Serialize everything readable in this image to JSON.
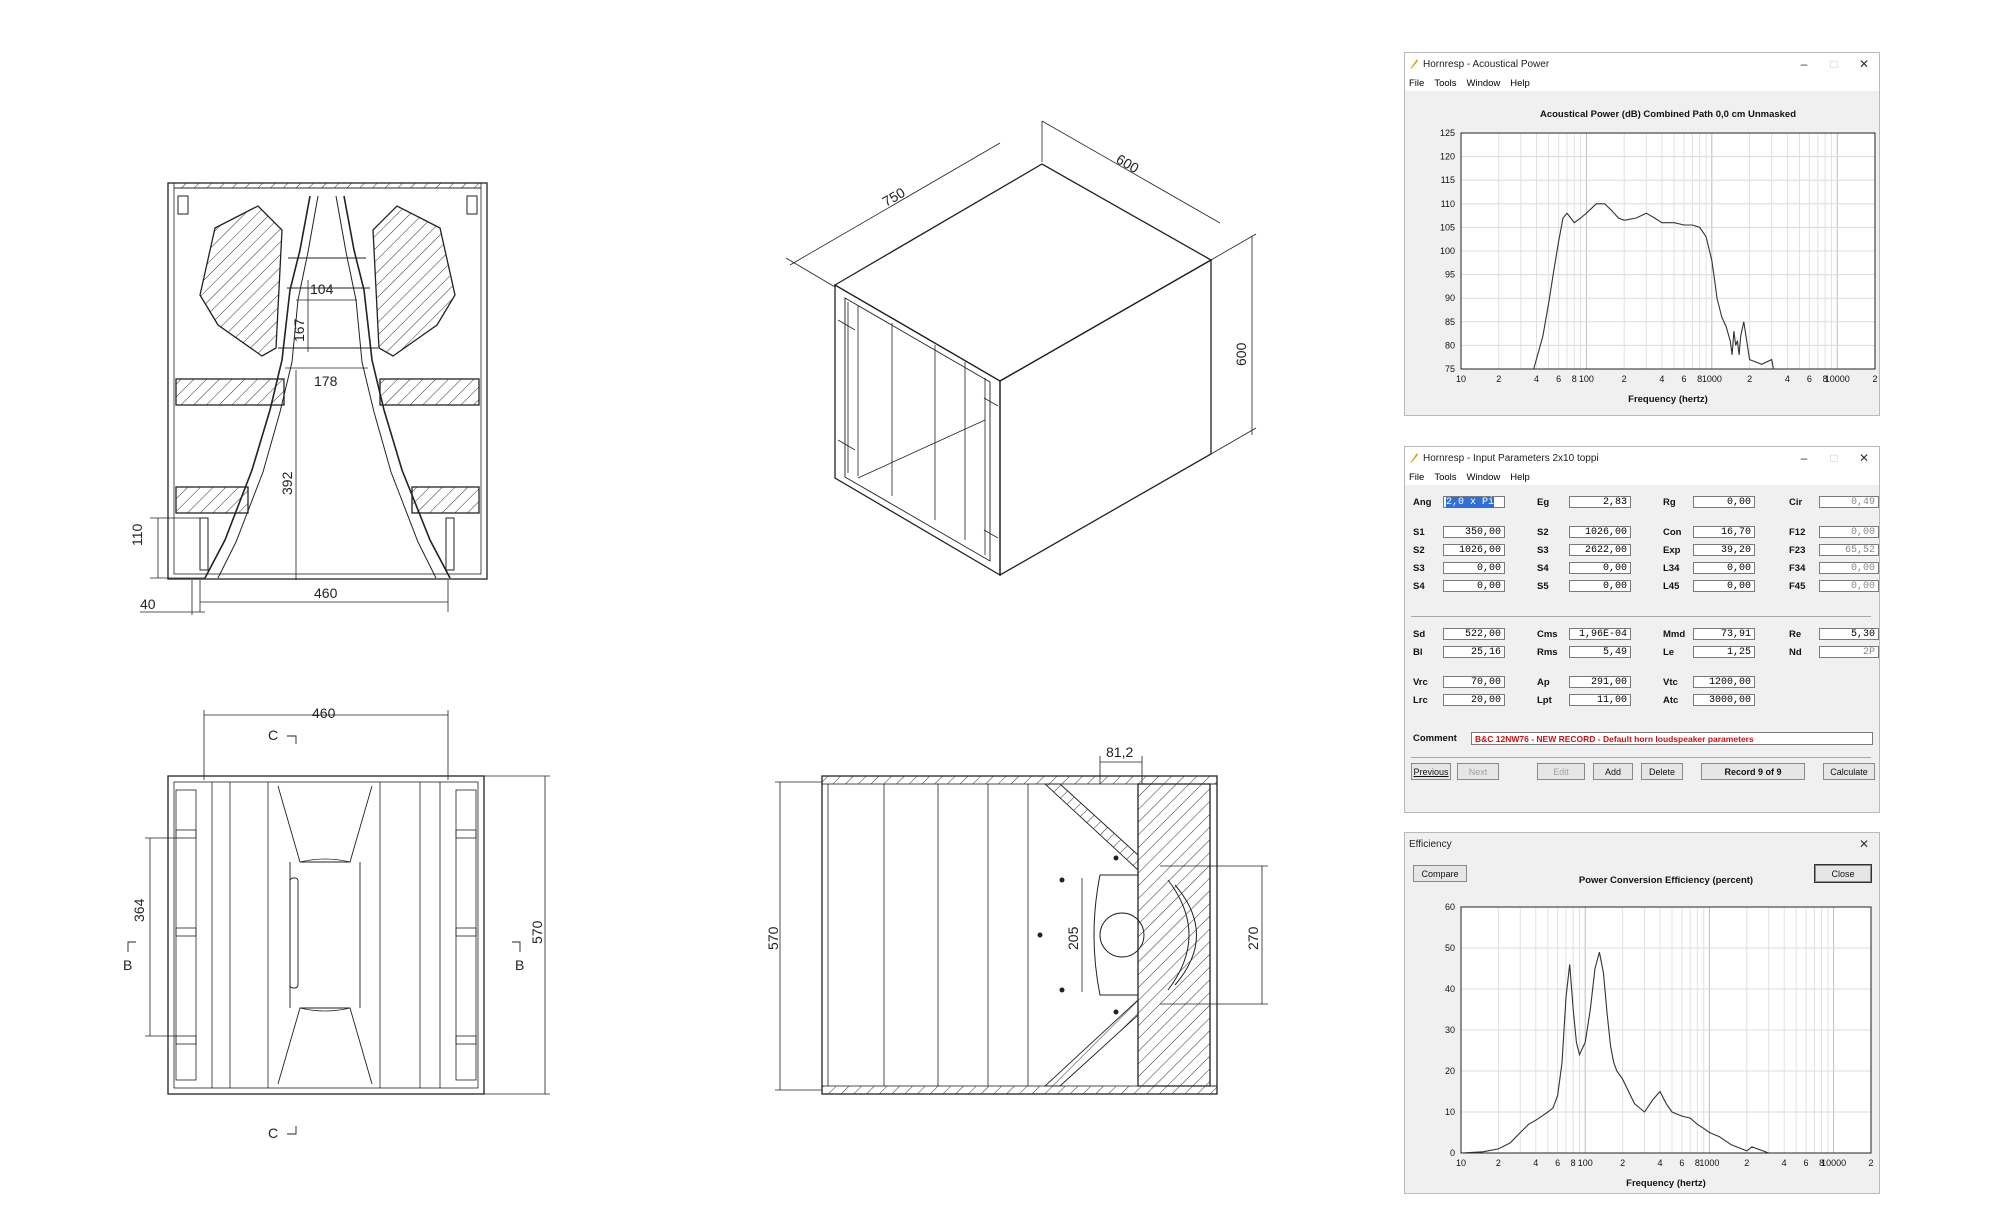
{
  "drawings": {
    "front_section": {
      "dims": {
        "horn_throat": "104",
        "throat_depth": "167",
        "mouth_mid": "178",
        "horn_length": "392",
        "foot_height": "110",
        "foot_offset": "40",
        "mouth_width": "460"
      }
    },
    "iso_view": {
      "dims": {
        "depth": "750",
        "width": "600",
        "height": "600"
      }
    },
    "top_section": {
      "dims": {
        "top_width": "460",
        "side_height": "364",
        "outer_height": "570"
      },
      "labels": {
        "cut_c_top": "C",
        "cut_c_bottom": "C",
        "cut_b_left": "B",
        "cut_b_right": "B"
      }
    },
    "side_section": {
      "dims": {
        "height": "570",
        "top": "81,2",
        "driver": "205",
        "mouth": "270"
      }
    }
  },
  "acoustical_window": {
    "title": "Hornresp - Acoustical Power",
    "menu": [
      "File",
      "Tools",
      "Window",
      "Help"
    ],
    "icons": {
      "app": "feather-icon",
      "min": "minimize-icon",
      "max": "maximize-icon",
      "close": "close-icon"
    }
  },
  "input_window": {
    "title": "Hornresp - Input Parameters  2x10 toppi",
    "menu": [
      "File",
      "Tools",
      "Window",
      "Help"
    ],
    "fields": {
      "Ang": "2,0 x Pi",
      "Eg": "2,83",
      "Rg": "0,00",
      "Cir": "0,49",
      "S1": "350,00",
      "S2a": "1026,00",
      "Con": "16,70",
      "F12": "0,00",
      "S2": "1026,00",
      "S3a": "2622,00",
      "Exp": "39,20",
      "F23": "65,52",
      "S3": "0,00",
      "S4a": "0,00",
      "L34": "0,00",
      "F34": "0,00",
      "S4": "0,00",
      "S5": "0,00",
      "L45": "0,00",
      "F45": "0,00",
      "Sd": "522,00",
      "Cms": "1,96E-04",
      "Mmd": "73,91",
      "Re": "5,30",
      "Bl": "25,16",
      "Rms": "5,49",
      "Le": "1,25",
      "Nd": "2P",
      "Vrc": "70,00",
      "Ap": "291,00",
      "Vtc": "1200,00",
      "Lrc": "20,00",
      "Lpt": "11,00",
      "Atc": "3000,00"
    },
    "labels": {
      "Ang": "Ang",
      "Eg": "Eg",
      "Rg": "Rg",
      "Cir": "Cir",
      "S1": "S1",
      "S2a": "S2",
      "Con": "Con",
      "F12": "F12",
      "S2": "S2",
      "S3a": "S3",
      "Exp": "Exp",
      "F23": "F23",
      "S3": "S3",
      "S4a": "S4",
      "L34": "L34",
      "F34": "F34",
      "S4": "S4",
      "S5": "S5",
      "L45": "L45",
      "F45": "F45",
      "Sd": "Sd",
      "Cms": "Cms",
      "Mmd": "Mmd",
      "Re": "Re",
      "Bl": "Bl",
      "Rms": "Rms",
      "Le": "Le",
      "Nd": "Nd",
      "Vrc": "Vrc",
      "Ap": "Ap",
      "Vtc": "Vtc",
      "Lrc": "Lrc",
      "Lpt": "Lpt",
      "Atc": "Atc"
    },
    "comment_label": "Comment",
    "comment": "B&C 12NW76 - NEW RECORD - Default horn loudspeaker parameters",
    "buttons": {
      "previous": "Previous",
      "next": "Next",
      "edit": "Edit",
      "add": "Add",
      "delete": "Delete",
      "record": "Record 9 of 9",
      "calculate": "Calculate"
    }
  },
  "efficiency_window": {
    "title": "Efficiency",
    "compare": "Compare",
    "close_btn": "Close"
  },
  "chart_data": [
    {
      "type": "line",
      "title": "Acoustical Power (dB)   Combined   Path 0,0 cm   Unmasked",
      "xlabel": "Frequency (hertz)",
      "ylabel": "",
      "xscale": "log",
      "xlim": [
        10,
        20000
      ],
      "ylim": [
        75,
        125
      ],
      "xticks": [
        "10",
        "2",
        "4",
        "6",
        "8",
        "100",
        "2",
        "4",
        "6",
        "8",
        "1000",
        "2",
        "4",
        "6",
        "8",
        "10000",
        "2"
      ],
      "yticks": [
        "125",
        "120",
        "115",
        "110",
        "105",
        "100",
        "95",
        "90",
        "85",
        "80",
        "75"
      ],
      "grid": true,
      "x": [
        38,
        45,
        50,
        55,
        60,
        65,
        70,
        75,
        80,
        90,
        100,
        120,
        140,
        160,
        180,
        200,
        250,
        300,
        350,
        400,
        500,
        600,
        700,
        800,
        900,
        1000,
        1050,
        1100,
        1200,
        1300,
        1400,
        1450,
        1500,
        1550,
        1600,
        1650,
        1700,
        1800,
        2000,
        2500,
        3000,
        3100
      ],
      "y": [
        75,
        82,
        89,
        96,
        102,
        107,
        108,
        107,
        106,
        107,
        108,
        110,
        110,
        108.5,
        107,
        106.5,
        107,
        108,
        107,
        106,
        106,
        105.5,
        105.5,
        105,
        103,
        98,
        94,
        90,
        86,
        84,
        81,
        78,
        83,
        80,
        81,
        78,
        82,
        85,
        77,
        76,
        77,
        75
      ]
    },
    {
      "type": "line",
      "title": "Power Conversion Efficiency (percent)",
      "xlabel": "Frequency (hertz)",
      "ylabel": "",
      "xscale": "log",
      "xlim": [
        10,
        20000
      ],
      "ylim": [
        0,
        60
      ],
      "xticks": [
        "10",
        "2",
        "4",
        "6",
        "8",
        "100",
        "2",
        "4",
        "6",
        "8",
        "1000",
        "2",
        "4",
        "6",
        "8",
        "10000",
        "2"
      ],
      "yticks": [
        "60",
        "50",
        "40",
        "30",
        "20",
        "10",
        "0"
      ],
      "grid": true,
      "x": [
        10,
        15,
        20,
        25,
        30,
        35,
        40,
        45,
        50,
        55,
        60,
        65,
        70,
        75,
        80,
        85,
        90,
        100,
        110,
        120,
        130,
        140,
        150,
        160,
        170,
        180,
        200,
        250,
        300,
        350,
        400,
        450,
        500,
        600,
        700,
        800,
        900,
        1000,
        1200,
        1500,
        2000,
        2200,
        3000
      ],
      "y": [
        0,
        0.3,
        1,
        2.5,
        5,
        7,
        8,
        9,
        10,
        11,
        14,
        22,
        38,
        46,
        35,
        27,
        24,
        27,
        35,
        45,
        49,
        44,
        34,
        26,
        22,
        20,
        18,
        12,
        10,
        13,
        15,
        12,
        10,
        9,
        8.5,
        7,
        6,
        5,
        4,
        2,
        0.5,
        1.5,
        0
      ]
    }
  ]
}
